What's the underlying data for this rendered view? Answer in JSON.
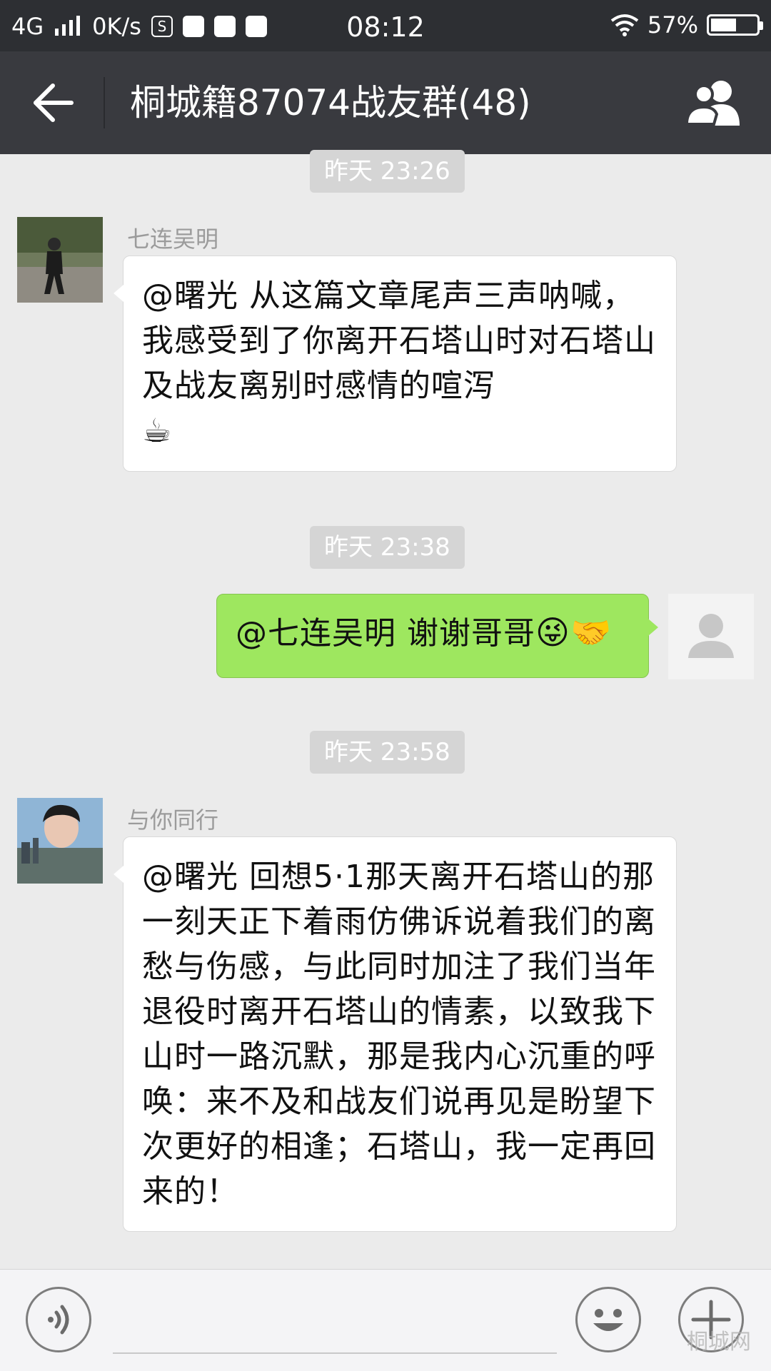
{
  "status_bar": {
    "network": "4G",
    "speed": "0K/s",
    "time": "08:12",
    "battery": "57%",
    "battery_level": 0.57
  },
  "header": {
    "title": "桐城籍87074战友群(48)"
  },
  "messages": [
    {
      "type": "time",
      "text": "昨天 23:26"
    },
    {
      "type": "incoming",
      "sender": "七连吴明",
      "text": "@曙光 从这篇文章尾声三声呐喊，我感受到了你离开石塔山时对石塔山及战友离别时感情的喧泻",
      "emoji": "☕"
    },
    {
      "type": "time",
      "text": "昨天 23:38"
    },
    {
      "type": "outgoing",
      "text": "@七连吴明 谢谢哥哥",
      "emoji": "😜🤝"
    },
    {
      "type": "time",
      "text": "昨天 23:58"
    },
    {
      "type": "incoming",
      "sender": "与你同行",
      "text": "@曙光 回想5·1那天离开石塔山的那一刻天正下着雨仿佛诉说着我们的离愁与伤感，与此同时加注了我们当年退役时离开石塔山的情素，以致我下山时一路沉默，那是我内心沉重的呼唤：来不及和战友们说再见是盼望下次更好的相逢；石塔山，我一定再回来的！"
    }
  ],
  "watermark": "桐城网",
  "colors": {
    "statusbar": "#2d2f33",
    "titlebar": "#393a3f",
    "chat_bg": "#ebebeb",
    "outgoing_bubble": "#9ee75f",
    "incoming_bubble": "#ffffff"
  }
}
